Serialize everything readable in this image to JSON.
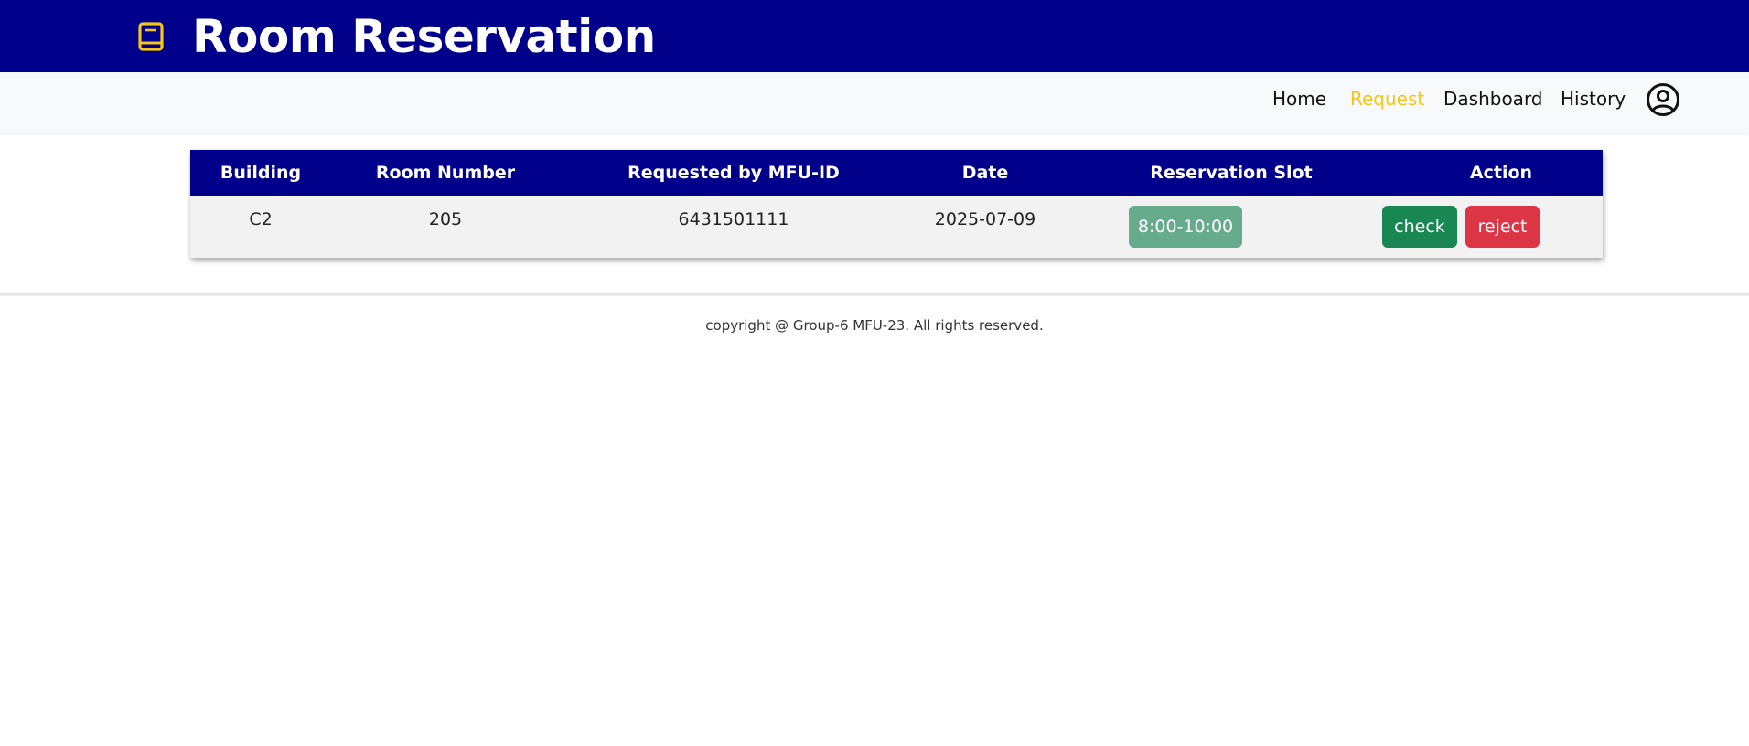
{
  "header": {
    "title": "Room Reservation",
    "icon": "book-icon",
    "icon_color": "#f5c518",
    "background": "#00008b"
  },
  "nav": {
    "items": [
      {
        "label": "Home",
        "active": false
      },
      {
        "label": "Request",
        "active": true
      },
      {
        "label": "Dashboard",
        "active": false
      },
      {
        "label": "History",
        "active": false
      }
    ],
    "active_color": "#f5c518",
    "user_icon": "user-circle-icon"
  },
  "table": {
    "headers": [
      "Building",
      "Room Number",
      "Requested by MFU-ID",
      "Date",
      "Reservation Slot",
      "Action"
    ],
    "rows": [
      {
        "building": "C2",
        "room_number": "205",
        "requested_by": "6431501111",
        "date": "2025-07-09",
        "slot": "8:00-10:00",
        "actions": {
          "check": "check",
          "reject": "reject"
        }
      }
    ],
    "header_color": "#00008b",
    "check_color": "#198754",
    "reject_color": "#dc3545",
    "slot_color": "#66ab8c"
  },
  "footer": {
    "text": "copyright @ Group-6 MFU-23. All rights reserved."
  }
}
